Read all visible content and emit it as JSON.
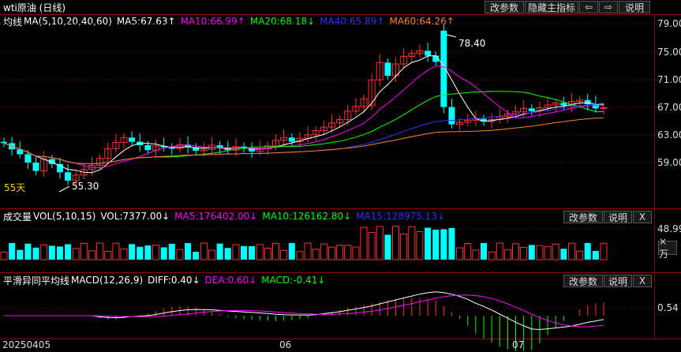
{
  "title": "wti原油 (日线)",
  "toolbar": {
    "change_params": "改参数",
    "hide_indicators": "隐藏主指标",
    "prev": "⇦",
    "next": "⇨",
    "help": "说明"
  },
  "main": {
    "ma_label": "均线",
    "ma_params": "MA(5,10,20,40,60)",
    "ma5": "MA5:67.63↑",
    "ma10": "MA10:66.99↑",
    "ma20": "MA20:68.18↓",
    "ma40": "MA40:65.89↑",
    "ma60": "MA60:64.26↑",
    "high_label": "78.40",
    "low_label": "55.30",
    "days_label": "55天",
    "y_ticks": [
      "79.00",
      "75.00",
      "71.00",
      "67.00",
      "63.00",
      "59.00"
    ]
  },
  "volume": {
    "label": "成交量",
    "params": "VOL(5,10,15)",
    "vol": "VOL:7377.00↓",
    "ma5": "MA5:176402.00↓",
    "ma10": "MA10:126162.80↓",
    "ma15": "MA15:128975.13↓",
    "change_params": "改参数",
    "help": "说明",
    "close": "X",
    "y_tick": "48.99",
    "unit_btn": "×万"
  },
  "macd": {
    "label": "平滑异同平均线",
    "params": "MACD(12,26,9)",
    "diff": "DIFF:0.40↓",
    "dea": "DEA:0.60↓",
    "macd": "MACD:-0.41↓",
    "change_params": "改参数",
    "help": "说明",
    "close": "X",
    "y_tick": "0.54"
  },
  "x_labels": [
    "20250405",
    "06",
    "07"
  ],
  "colors": {
    "up": "#ff3030",
    "down": "#00ffff",
    "ma5": "#ffffff",
    "ma10": "#ff00ff",
    "ma20": "#00ff00",
    "ma40": "#3030ff",
    "ma60": "#ff8020"
  }
}
